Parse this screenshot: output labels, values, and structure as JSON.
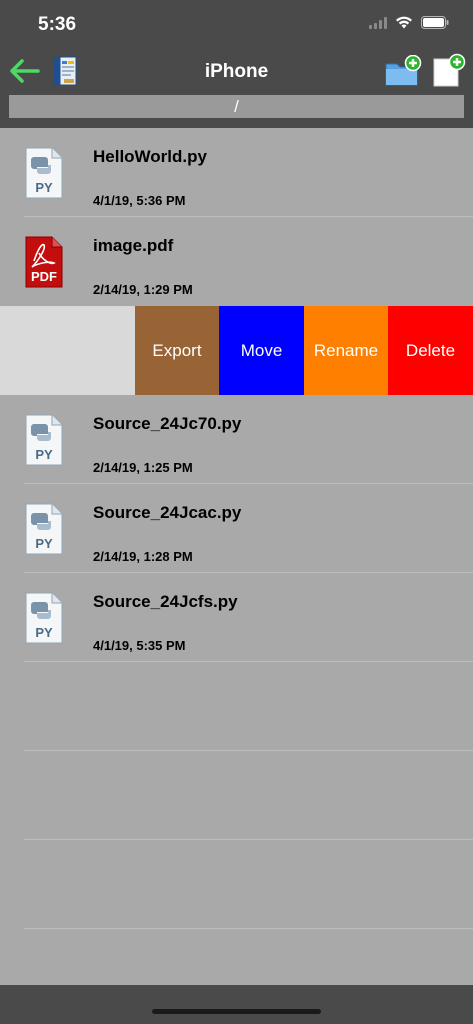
{
  "status_bar": {
    "time": "5:36"
  },
  "nav": {
    "title": "iPhone",
    "path": "/"
  },
  "files": [
    {
      "name": "HelloWorld.py",
      "date": "4/1/19, 5:36 PM",
      "type": "py",
      "icon_label": "PY"
    },
    {
      "name": "image.pdf",
      "date": "2/14/19, 1:29 PM",
      "type": "pdf",
      "icon_label": "PDF"
    }
  ],
  "swipe_actions": [
    {
      "label": "Export",
      "color": "#986436"
    },
    {
      "label": "Move",
      "color": "#0000ff"
    },
    {
      "label": "Rename",
      "color": "#ff8000"
    },
    {
      "label": "Delete",
      "color": "#ff0000"
    }
  ],
  "files_after": [
    {
      "name": "Source_24Jc70.py",
      "date": "2/14/19, 1:25 PM",
      "type": "py",
      "icon_label": "PY"
    },
    {
      "name": "Source_24Jcac.py",
      "date": "2/14/19, 1:28 PM",
      "type": "py",
      "icon_label": "PY"
    },
    {
      "name": "Source_24Jcfs.py",
      "date": "4/1/19, 5:35 PM",
      "type": "py",
      "icon_label": "PY"
    }
  ],
  "colors": {
    "bar": "#4a4a4a",
    "list_bg": "#a9a9a9",
    "back_arrow": "#4cd964",
    "plus_badge": "#2bb52b"
  },
  "icons": [
    "back-arrow-icon",
    "app-icon",
    "new-folder-icon",
    "new-file-icon",
    "signal-icon",
    "wifi-icon",
    "battery-icon",
    "python-file-icon",
    "pdf-file-icon"
  ]
}
